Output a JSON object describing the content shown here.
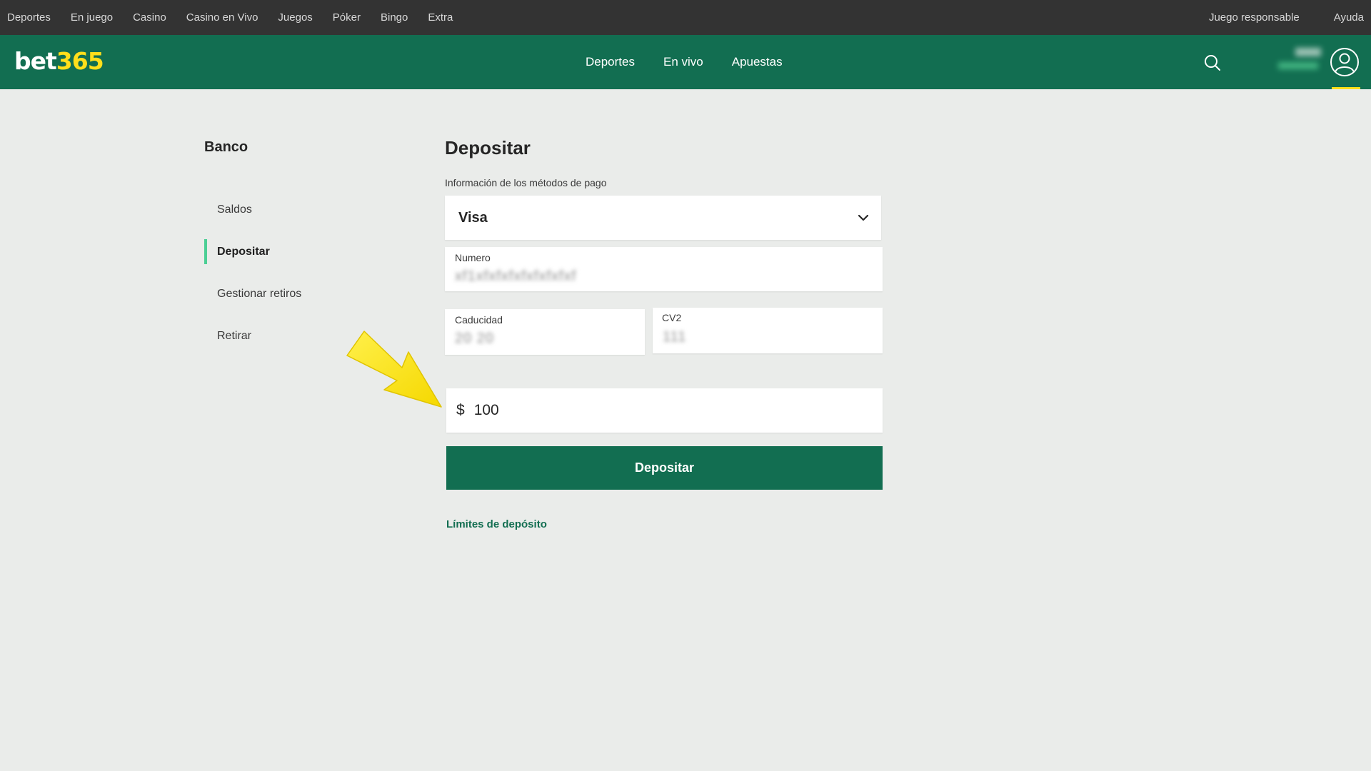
{
  "topbar": {
    "links": [
      "Deportes",
      "En juego",
      "Casino",
      "Casino en Vivo",
      "Juegos",
      "Póker",
      "Bingo",
      "Extra"
    ],
    "responsible": "Juego responsable",
    "help": "Ayuda"
  },
  "header": {
    "logo_main": "bet",
    "logo_accent": "365",
    "nav": [
      "Deportes",
      "En vivo",
      "Apuestas"
    ],
    "icons": {
      "search": "search-icon",
      "account": "user-circle-icon"
    },
    "colors": {
      "header_bg": "#126e51",
      "accent": "#ffdf1b",
      "topbar_bg": "#333333"
    }
  },
  "sidebar": {
    "title": "Banco",
    "items": [
      {
        "label": "Saldos",
        "active": false
      },
      {
        "label": "Depositar",
        "active": true
      },
      {
        "label": "Gestionar retiros",
        "active": false
      },
      {
        "label": "Retirar",
        "active": false
      }
    ],
    "active_marker_color": "#4ccf95"
  },
  "form": {
    "title": "Depositar",
    "payment_label": "Información de los métodos de pago",
    "payment_method": "Visa",
    "number_label": "Numero",
    "number_value": "xf1xfxfxfxfxfxfxfxf",
    "expiry_label": "Caducidad",
    "expiry_value": "20 20",
    "cv2_label": "CV2",
    "cv2_value": "111",
    "currency_symbol": "$",
    "amount": "100",
    "submit_label": "Depositar",
    "limits_link": "Límites de depósito"
  }
}
